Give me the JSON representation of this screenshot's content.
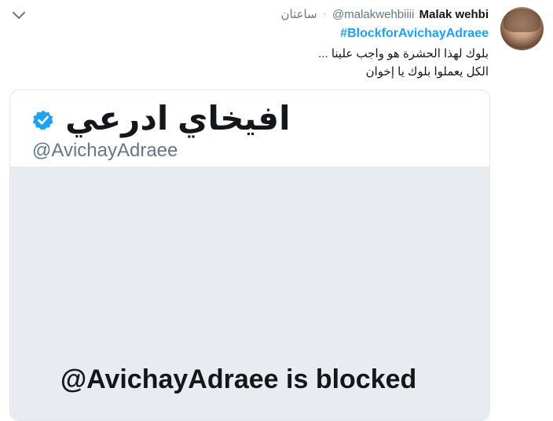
{
  "tweet": {
    "author_name": "Malak wehbi",
    "author_handle": "@malakwehbiiii",
    "separator": "·",
    "time": "ساعتان",
    "hashtag": "#BlockforAvichayAdraee",
    "lines": [
      "بلوك لهذا الحشرة هو واجب علينا ...",
      "الكل يعملوا بلوك يا إخوان"
    ],
    "menu_icon": "chevron-down-icon"
  },
  "card": {
    "display_name": "افيخاي ادرعي",
    "handle": "@AvichayAdraee",
    "blocked_text": "@AvichayAdraee is blocked",
    "verified_icon": "verified-badge-icon",
    "verified_color": "#1da1f2"
  },
  "colors": {
    "link": "#1da1f2",
    "muted": "#657786",
    "text": "#14171a",
    "card_gray": "#e8ebef"
  }
}
